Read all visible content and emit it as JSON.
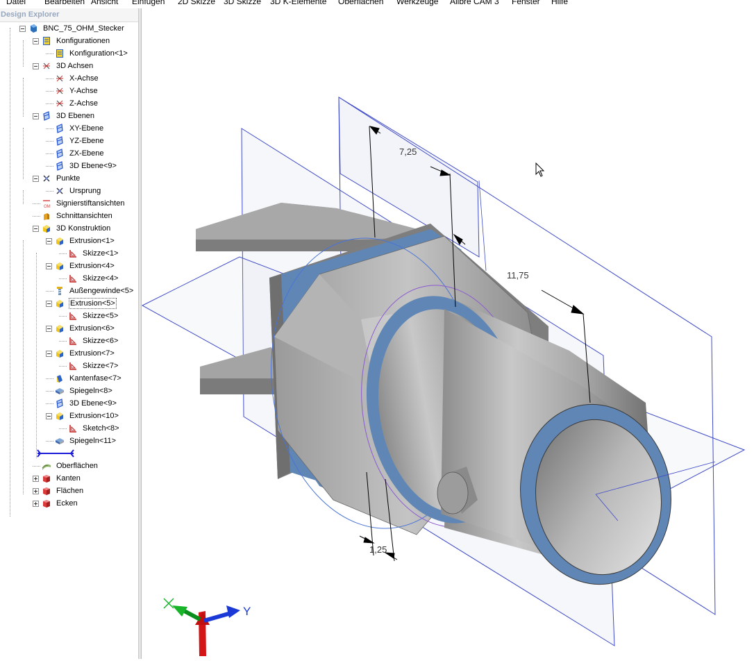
{
  "menu": [
    "Datei",
    "Bearbeiten",
    "Ansicht",
    "Einfügen",
    "2D Skizze",
    "3D Skizze",
    "3D K-Elemente",
    "Oberflächen",
    "Werkzeuge",
    "Alibre CAM 3",
    "Fenster",
    "Hilfe"
  ],
  "explorer": {
    "title": "Design Explorer",
    "nodes": [
      {
        "label": "BNC_75_OHM_Stecker",
        "icon": "part-icon",
        "expand": "minus"
      },
      {
        "label": "Konfigurationen",
        "icon": "configurations-icon",
        "expand": "minus"
      },
      {
        "label": "Konfiguration<1>",
        "icon": "configuration-icon",
        "expand": ""
      },
      {
        "label": "3D Achsen",
        "icon": "axes-icon",
        "expand": "minus"
      },
      {
        "label": "X-Achse",
        "icon": "axis-icon",
        "expand": ""
      },
      {
        "label": "Y-Achse",
        "icon": "axis-icon",
        "expand": ""
      },
      {
        "label": "Z-Achse",
        "icon": "axis-icon",
        "expand": ""
      },
      {
        "label": "3D Ebenen",
        "icon": "planes-icon",
        "expand": "minus"
      },
      {
        "label": "XY-Ebene",
        "icon": "plane-icon",
        "expand": ""
      },
      {
        "label": "YZ-Ebene",
        "icon": "plane-icon",
        "expand": ""
      },
      {
        "label": "ZX-Ebene",
        "icon": "plane-icon",
        "expand": ""
      },
      {
        "label": "3D Ebene<9>",
        "icon": "plane-icon",
        "expand": ""
      },
      {
        "label": "Punkte",
        "icon": "points-icon",
        "expand": "minus"
      },
      {
        "label": "Ursprung",
        "icon": "origin-icon",
        "expand": ""
      },
      {
        "label": "Signierstiftansichten",
        "icon": "pen-views-icon",
        "expand": ""
      },
      {
        "label": "Schnittansichten",
        "icon": "section-views-icon",
        "expand": ""
      },
      {
        "label": "3D Konstruktion",
        "icon": "construction-icon",
        "expand": "minus"
      },
      {
        "label": "Extrusion<1>",
        "icon": "extrusion-icon",
        "expand": "minus"
      },
      {
        "label": "Skizze<1>",
        "icon": "sketch-icon",
        "expand": ""
      },
      {
        "label": "Extrusion<4>",
        "icon": "extrusion-icon",
        "expand": "minus"
      },
      {
        "label": "Skizze<4>",
        "icon": "sketch-icon",
        "expand": ""
      },
      {
        "label": "Außengewinde<5>",
        "icon": "thread-icon",
        "expand": ""
      },
      {
        "label": "Extrusion<5>",
        "icon": "extrusion-icon",
        "expand": "minus"
      },
      {
        "label": "Skizze<5>",
        "icon": "sketch-icon",
        "expand": ""
      },
      {
        "label": "Extrusion<6>",
        "icon": "extrusion-icon",
        "expand": "minus"
      },
      {
        "label": "Skizze<6>",
        "icon": "sketch-icon",
        "expand": ""
      },
      {
        "label": "Extrusion<7>",
        "icon": "extrusion-icon",
        "expand": "minus"
      },
      {
        "label": "Skizze<7>",
        "icon": "sketch-icon",
        "expand": ""
      },
      {
        "label": "Kantenfase<7>",
        "icon": "chamfer-icon",
        "expand": ""
      },
      {
        "label": "Spiegeln<8>",
        "icon": "mirror-icon",
        "expand": ""
      },
      {
        "label": "3D Ebene<9>",
        "icon": "plane-icon",
        "expand": ""
      },
      {
        "label": "Extrusion<10>",
        "icon": "extrusion-icon",
        "expand": "minus"
      },
      {
        "label": "Sketch<8>",
        "icon": "sketch-icon",
        "expand": ""
      },
      {
        "label": "Spiegeln<11>",
        "icon": "mirror-icon",
        "expand": ""
      },
      {
        "label": "",
        "icon": "rollback-bar-icon",
        "expand": ""
      },
      {
        "label": "Oberflächen",
        "icon": "surfaces-icon",
        "expand": ""
      },
      {
        "label": "Kanten",
        "icon": "edges-icon",
        "expand": "plus"
      },
      {
        "label": "Flächen",
        "icon": "faces-icon",
        "expand": "plus"
      },
      {
        "label": "Ecken",
        "icon": "vertices-icon",
        "expand": "plus"
      }
    ],
    "selected": "Extrusion<5>"
  },
  "viewport": {
    "dimensions": [
      "7,25",
      "11,75",
      "1,25"
    ],
    "triad": {
      "x": "X",
      "y": "Y"
    },
    "colors": {
      "body": "#9a9a9a",
      "face": "#5f86b4",
      "plane": "#3d49c7",
      "circle": "#4a74d6"
    }
  }
}
